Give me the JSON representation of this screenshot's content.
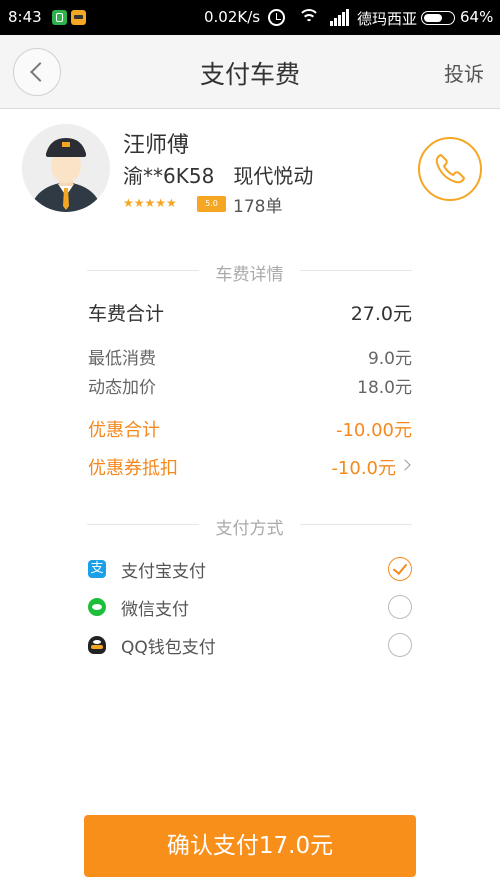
{
  "status_bar": {
    "time": "8:43",
    "net_speed": "0.02K/s",
    "carrier": "德玛西亚",
    "battery_pct": "64%",
    "battery_level": 0.64
  },
  "nav": {
    "title": "支付车费",
    "complain_label": "投诉"
  },
  "driver": {
    "name": "汪师傅",
    "car": "渝**6K58   现代悦动",
    "stars": "★★★★★",
    "rating": "5.0",
    "orders": "178单"
  },
  "fare": {
    "section_title": "车费详情",
    "total_label": "车费合计",
    "total_value": "27.0元",
    "items": [
      {
        "label": "最低消费",
        "value": "9.0元"
      },
      {
        "label": "动态加价",
        "value": "18.0元"
      }
    ],
    "discount_label": "优惠合计",
    "discount_value": "-10.00元",
    "coupon_label": "优惠券抵扣",
    "coupon_value": "-10.0元"
  },
  "payment": {
    "section_title": "支付方式",
    "methods": [
      {
        "label": "支付宝支付",
        "icon": "alipay-icon",
        "selected": true,
        "glyph": "支"
      },
      {
        "label": "微信支付",
        "icon": "wechat-icon",
        "selected": false
      },
      {
        "label": "QQ钱包支付",
        "icon": "qq-wallet-icon",
        "selected": false
      }
    ]
  },
  "confirm_label": "确认支付17.0元",
  "colors": {
    "accent": "#f88f1b",
    "discount_text": "#f5891e",
    "alipay": "#1aa0e8",
    "wechat": "#1dbf3a"
  }
}
